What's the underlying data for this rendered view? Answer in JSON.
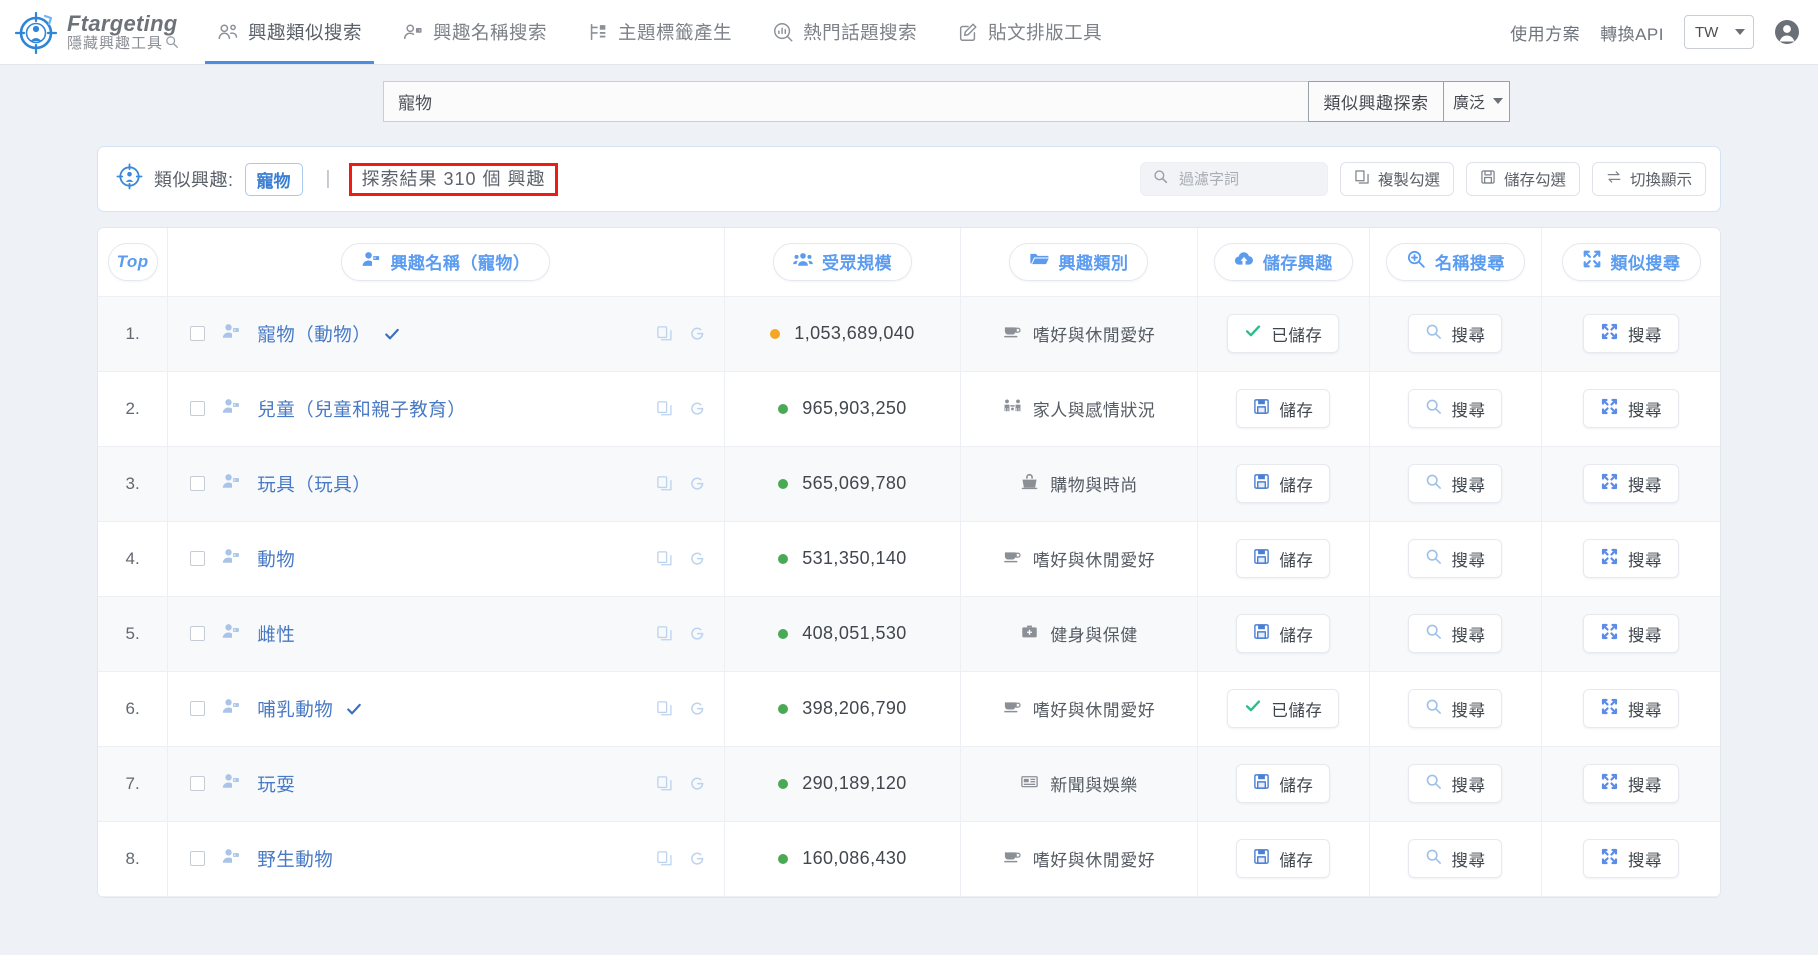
{
  "brand": {
    "name": "Ftargeting",
    "subtitle": "隱藏興趣工具",
    "logo_icon": "target-person-icon",
    "sub_icon": "magnifier-icon"
  },
  "nav": {
    "items": [
      {
        "label": "興趣類似搜索",
        "icon": "users-similar-icon",
        "active": true
      },
      {
        "label": "興趣名稱搜索",
        "icon": "user-tag-icon",
        "active": false
      },
      {
        "label": "主題標籤產生",
        "icon": "hashtag-blocks-icon",
        "active": false
      },
      {
        "label": "熱門話題搜索",
        "icon": "trending-circle-icon",
        "active": false
      },
      {
        "label": "貼文排版工具",
        "icon": "pencil-square-icon",
        "active": false
      }
    ],
    "right": {
      "plans_label": "使用方案",
      "api_label": "轉換API",
      "language": "TW",
      "language_caret_icon": "chevron-down-icon",
      "account_icon": "account-circle-icon"
    }
  },
  "search": {
    "value": "寵物",
    "placeholder": "",
    "button_label": "類似興趣探索",
    "scope_value": "廣泛",
    "scope_caret_icon": "chevron-down-icon"
  },
  "info": {
    "target_icon": "target-person-icon",
    "label": "類似興趣:",
    "keyword": "寵物",
    "separator": "|",
    "result_text": "探索結果 310 個 興趣",
    "result_highlight_color": "#ee1c11",
    "filter": {
      "icon": "search-icon",
      "placeholder": "過濾字詞",
      "value": ""
    },
    "actions": [
      {
        "label": "複製勾選",
        "icon": "copy-icon"
      },
      {
        "label": "儲存勾選",
        "icon": "floppy-icon"
      },
      {
        "label": "切換顯示",
        "icon": "swap-arrows-icon"
      }
    ]
  },
  "table": {
    "headers": [
      {
        "label": "Top",
        "icon": ""
      },
      {
        "label": "興趣名稱（寵物）",
        "icon": "user-tag-icon"
      },
      {
        "label": "受眾規模",
        "icon": "users-group-icon"
      },
      {
        "label": "興趣類別",
        "icon": "folder-icon"
      },
      {
        "label": "儲存興趣",
        "icon": "cloud-upload-icon"
      },
      {
        "label": "名稱搜尋",
        "icon": "zoom-in-icon"
      },
      {
        "label": "類似搜尋",
        "icon": "expand-arrows-icon"
      }
    ],
    "row_icons": {
      "copy": "copy-icon",
      "google": "google-g-icon",
      "tag": "user-tag-icon",
      "checkmark": "check-icon"
    },
    "dot_colors": {
      "amber": "#f5a623",
      "green": "#49a954"
    },
    "rows": [
      {
        "index": "1.",
        "name": "寵物（動物）",
        "saved_check": true,
        "size": "1,053,689,040",
        "dot": "amber",
        "category": "嗜好與休閒愛好",
        "category_icon": "coffee-cup-icon",
        "save_label": "已儲存",
        "save_state": "saved",
        "name_search_label": "搜尋",
        "similar_search_label": "搜尋"
      },
      {
        "index": "2.",
        "name": "兒童（兒童和親子教育）",
        "saved_check": false,
        "size": "965,903,250",
        "dot": "green",
        "category": "家人與感情狀況",
        "category_icon": "family-icon",
        "save_label": "儲存",
        "save_state": "unsaved",
        "name_search_label": "搜尋",
        "similar_search_label": "搜尋"
      },
      {
        "index": "3.",
        "name": "玩具（玩具）",
        "saved_check": false,
        "size": "565,069,780",
        "dot": "green",
        "category": "購物與時尚",
        "category_icon": "shopping-basket-icon",
        "save_label": "儲存",
        "save_state": "unsaved",
        "name_search_label": "搜尋",
        "similar_search_label": "搜尋"
      },
      {
        "index": "4.",
        "name": "動物",
        "saved_check": false,
        "size": "531,350,140",
        "dot": "green",
        "category": "嗜好與休閒愛好",
        "category_icon": "coffee-cup-icon",
        "save_label": "儲存",
        "save_state": "unsaved",
        "name_search_label": "搜尋",
        "similar_search_label": "搜尋"
      },
      {
        "index": "5.",
        "name": "雌性",
        "saved_check": false,
        "size": "408,051,530",
        "dot": "green",
        "category": "健身與保健",
        "category_icon": "medical-kit-icon",
        "save_label": "儲存",
        "save_state": "unsaved",
        "name_search_label": "搜尋",
        "similar_search_label": "搜尋"
      },
      {
        "index": "6.",
        "name": "哺乳動物",
        "saved_check": true,
        "size": "398,206,790",
        "dot": "green",
        "category": "嗜好與休閒愛好",
        "category_icon": "coffee-cup-icon",
        "save_label": "已儲存",
        "save_state": "saved",
        "name_search_label": "搜尋",
        "similar_search_label": "搜尋"
      },
      {
        "index": "7.",
        "name": "玩耍",
        "saved_check": false,
        "size": "290,189,120",
        "dot": "green",
        "category": "新聞與娛樂",
        "category_icon": "news-icon",
        "save_label": "儲存",
        "save_state": "unsaved",
        "name_search_label": "搜尋",
        "similar_search_label": "搜尋"
      },
      {
        "index": "8.",
        "name": "野生動物",
        "saved_check": false,
        "size": "160,086,430",
        "dot": "green",
        "category": "嗜好與休閒愛好",
        "category_icon": "coffee-cup-icon",
        "save_label": "儲存",
        "save_state": "unsaved",
        "name_search_label": "搜尋",
        "similar_search_label": "搜尋"
      }
    ]
  }
}
